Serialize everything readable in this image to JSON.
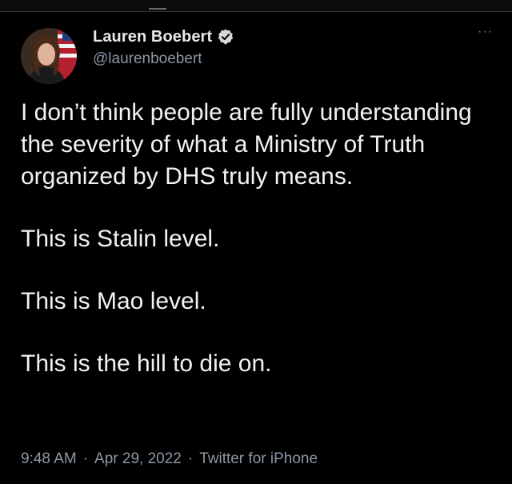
{
  "tweet": {
    "author": {
      "display_name": "Lauren Boebert",
      "handle": "@laurenboebert",
      "verified_icon": "verified-badge-icon",
      "avatar_icon": "avatar"
    },
    "more_icon": "more-options-icon",
    "more_label": "···",
    "paragraphs": [
      "I don’t think people are fully understanding the severity of what a Ministry of Truth organized by DHS truly means.",
      "This is Stalin level.",
      "This is Mao level.",
      "This is the hill to die on."
    ],
    "meta": {
      "time": "9:48 AM",
      "separator": "·",
      "date": "Apr 29, 2022",
      "source": "Twitter for iPhone"
    }
  },
  "colors": {
    "background": "#000000",
    "text": "#e7e9ea",
    "secondary_text": "#8b98a5",
    "verified": "#d9d9d9"
  }
}
